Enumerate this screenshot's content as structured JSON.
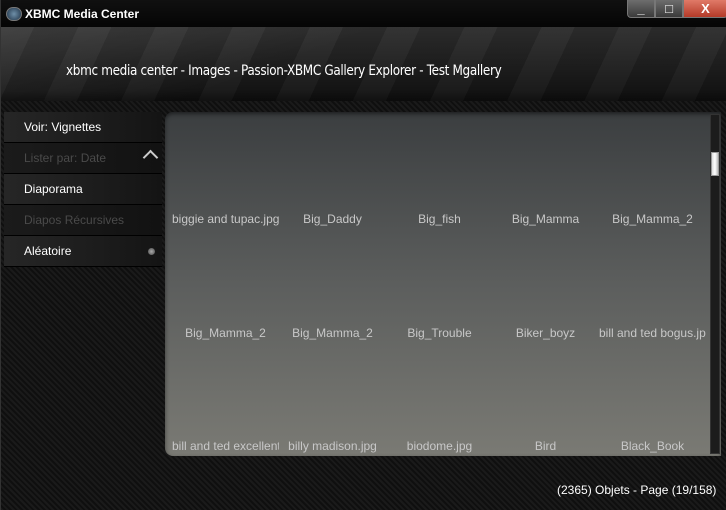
{
  "window": {
    "title": "XBMC Media Center",
    "minimize_label": "_",
    "maximize_label": "□",
    "close_label": "X"
  },
  "header": {
    "breadcrumb": "xbmc media center - Images - Passion-XBMC Gallery Explorer - Test Mgallery"
  },
  "sidebar": {
    "items": [
      {
        "label": "Voir: Vignettes",
        "enabled": true
      },
      {
        "label": "Lister par: Date",
        "enabled": false,
        "icon": "chevron-up-icon"
      },
      {
        "label": "Diaporama",
        "enabled": true
      },
      {
        "label": "Diapos Récursives",
        "enabled": false
      },
      {
        "label": "Aléatoire",
        "enabled": true,
        "icon": "radio-indicator-icon"
      }
    ]
  },
  "grid": {
    "rows": [
      [
        "biggie and tupac.jpg",
        "Big_Daddy",
        "Big_fish",
        "Big_Mamma",
        "Big_Mamma_2"
      ],
      [
        "Big_Mamma_2",
        "Big_Mamma_2",
        "Big_Trouble",
        "Biker_boyz",
        "bill and ted bogus.jpg"
      ],
      [
        "bill and ted excellent.j",
        "billy madison.jpg",
        "biodome.jpg",
        "Bird",
        "Black_Book"
      ]
    ]
  },
  "status": {
    "text": "(2365) Objets - Page (19/158)"
  }
}
